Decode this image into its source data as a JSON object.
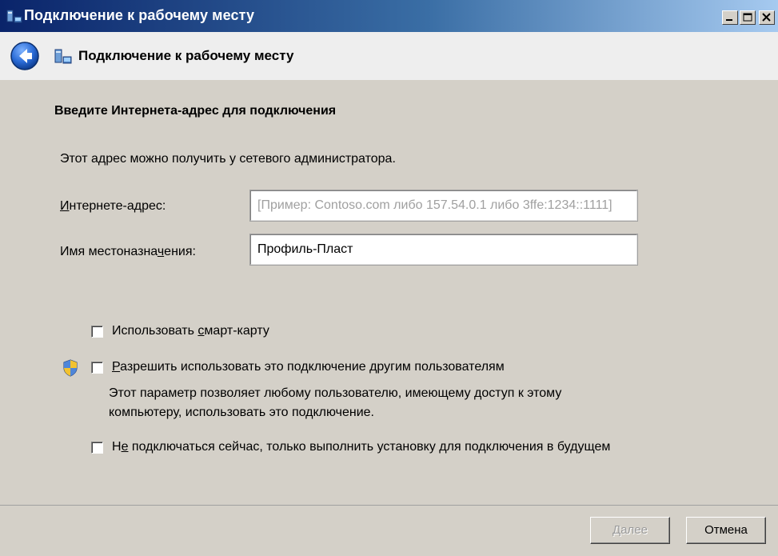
{
  "window": {
    "title": "Подключение к рабочему месту"
  },
  "header": {
    "title": "Подключение к рабочему месту"
  },
  "main": {
    "heading": "Введите Интернета-адрес для подключения",
    "description": "Этот адрес можно получить у сетевого администратора.",
    "address_label": "Интернете-адрес:",
    "address_placeholder": "[Пример: Contoso.com либо 157.54.0.1 либо 3ffe:1234::1111]",
    "destination_label": "Имя местоназначения:",
    "destination_value": "Профиль-Пласт"
  },
  "options": {
    "smartcard_label": "Использовать смарт-карту",
    "smartcard_checked": false,
    "share_label": "Разрешить использовать это подключение другим пользователям",
    "share_checked": false,
    "share_note_line1": "Этот параметр позволяет любому пользователю, имеющему доступ к этому",
    "share_note_line2": "компьютеру, использовать это подключение.",
    "later_label": "Не подключаться сейчас, только выполнить установку для подключения в будущем",
    "later_checked": false
  },
  "footer": {
    "next_label": "Далее",
    "cancel_label": "Отмена"
  },
  "colors": {
    "titlebar_start": "#0a246a",
    "titlebar_end": "#a6caf0",
    "face": "#d4d0c8",
    "header_bg": "#eeeeee",
    "back_button": "#2a6bd6"
  }
}
